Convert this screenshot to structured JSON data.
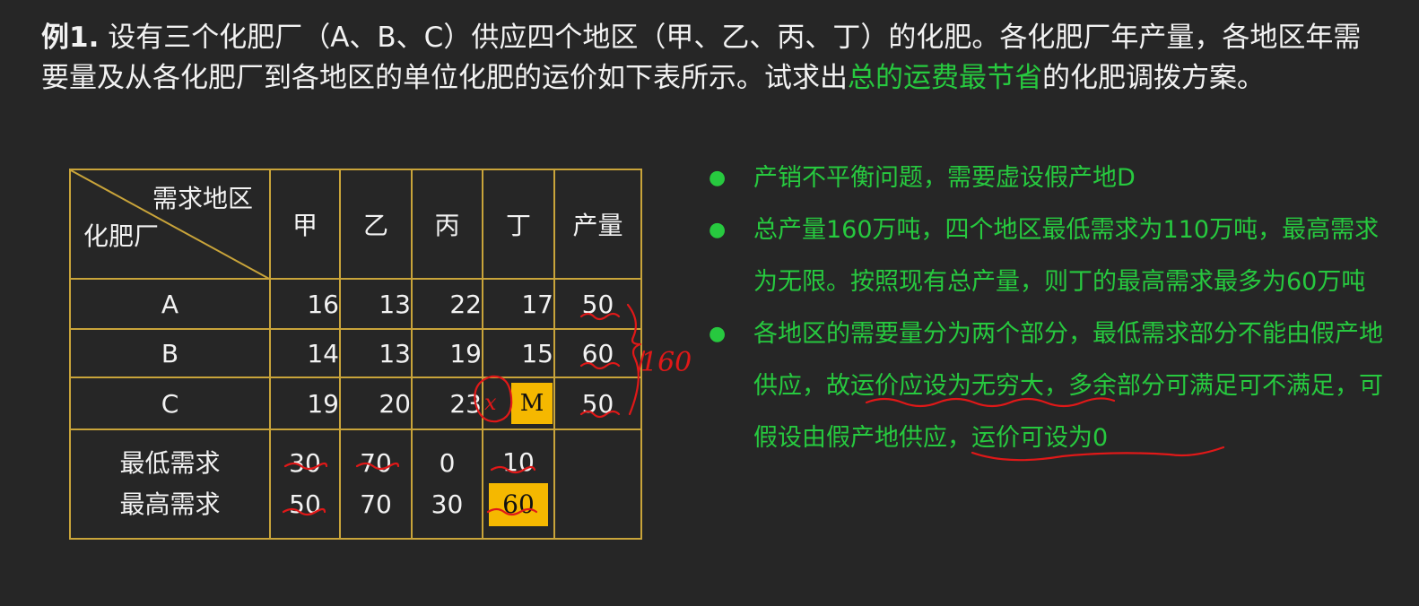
{
  "intro": {
    "label": "例1.",
    "text_before": " 设有三个化肥厂（A、B、C）供应四个地区（甲、乙、丙、丁）的化肥。各化肥厂年产量，各地区年需要量及从各化肥厂到各地区的单位化肥的运价如下表所示。试求出",
    "highlight": "总的运费最节省",
    "text_after": "的化肥调拨方案。"
  },
  "table": {
    "corner_top": "需求地区",
    "corner_bottom": "化肥厂",
    "headers": [
      "甲",
      "乙",
      "丙",
      "丁",
      "产量"
    ],
    "rows": [
      {
        "factory": "A",
        "costs": [
          "16",
          "13",
          "22",
          "17"
        ],
        "output": "50"
      },
      {
        "factory": "B",
        "costs": [
          "14",
          "13",
          "19",
          "15"
        ],
        "output": "60"
      },
      {
        "factory": "C",
        "costs": [
          "19",
          "20",
          "23",
          "M"
        ],
        "output": "50"
      }
    ],
    "demand_labels": [
      "最低需求",
      "最高需求"
    ],
    "min_demand": [
      "30",
      "70",
      "0",
      "10"
    ],
    "max_demand": [
      "50",
      "70",
      "30",
      "60"
    ]
  },
  "annotations": {
    "total_output_note": "160",
    "circle_note": "x"
  },
  "bullets": [
    "产销不平衡问题，需要虚设假产地D",
    "总产量160万吨，四个地区最低需求为110万吨，最高需求为无限。按照现有总产量，则丁的最高需求最多为60万吨",
    "各地区的需要量分为两个部分，最低需求部分不能由假产地供应，故运价应设为无穷大，多余部分可满足可不满足，可假设由假产地供应，运价可设为0"
  ],
  "colors": {
    "background": "#262626",
    "highlight_green": "#27c93f",
    "table_border": "#c9a43a",
    "cell_fill": "#f5b800",
    "ink_red": "#e01818"
  }
}
